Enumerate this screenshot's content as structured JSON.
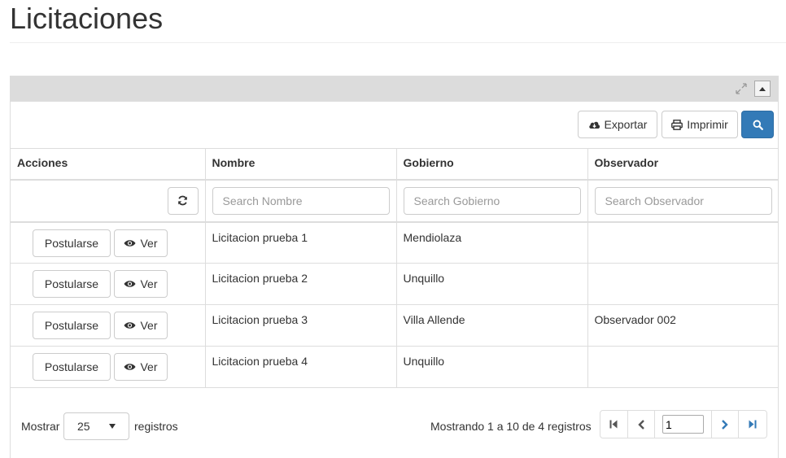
{
  "page": {
    "title": "Licitaciones"
  },
  "toolbar": {
    "export_label": "Exportar",
    "print_label": "Imprimir"
  },
  "table": {
    "headers": [
      "Acciones",
      "Nombre",
      "Gobierno",
      "Observador"
    ],
    "filters": {
      "nombre_placeholder": "Search Nombre",
      "gobierno_placeholder": "Search Gobierno",
      "observador_placeholder": "Search Observador"
    },
    "actions": {
      "postular_label": "Postularse",
      "ver_label": "Ver"
    },
    "rows": [
      {
        "nombre": "Licitacion prueba 1",
        "gobierno": "Mendiolaza",
        "observador": ""
      },
      {
        "nombre": "Licitacion prueba 2",
        "gobierno": "Unquillo",
        "observador": ""
      },
      {
        "nombre": "Licitacion prueba 3",
        "gobierno": "Villa Allende",
        "observador": "Observador 002"
      },
      {
        "nombre": "Licitacion prueba 4",
        "gobierno": "Unquillo",
        "observador": ""
      }
    ]
  },
  "footer": {
    "show_label": "Mostrar",
    "length_value": "25",
    "records_label": "registros",
    "info": "Mostrando 1 a 10 de 4 registros",
    "page_input": "1"
  },
  "colors": {
    "primary": "#337ab7",
    "heading_bg": "#dcdcdc",
    "border": "#dddddd"
  }
}
